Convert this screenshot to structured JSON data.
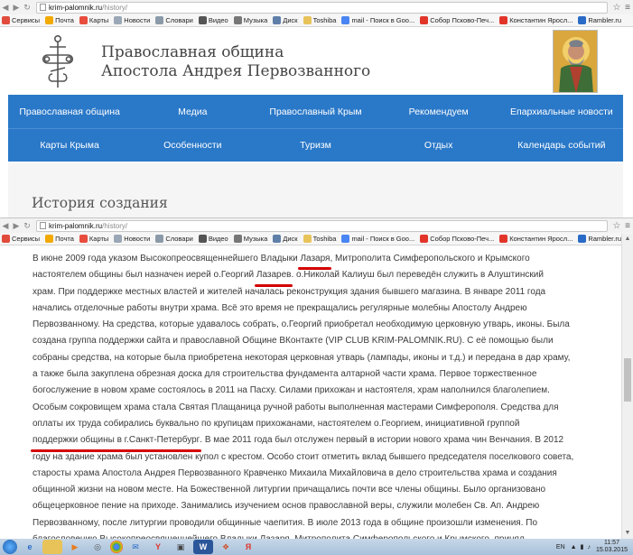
{
  "browser": {
    "url_domain": "krim-palomnik.ru",
    "url_path": "/history/",
    "bookmarks": [
      "Сервисы",
      "Почта",
      "Карты",
      "Новости",
      "Словари",
      "Видео",
      "Музыка",
      "Диск",
      "Toshiba",
      "mail - Поиск в Goo...",
      "Собор Псково-Печ...",
      "Константин Яросл...",
      "Rambler.ru"
    ]
  },
  "site": {
    "title_line1": "Православная община",
    "title_line2": "Апостола Андрея Первозванного"
  },
  "nav": {
    "row1": [
      "Православная община",
      "Медиа",
      "Православный Крым",
      "Рекомендуем",
      "Епархиальные новости"
    ],
    "row2": [
      "Карты Крыма",
      "Особенности",
      "Туризм",
      "Отдых",
      "Календарь событий"
    ]
  },
  "page_heading": "История создания",
  "article": {
    "l01": {
      "a": "В июне 2009 года указом Высокопреосвященнейшего Владыки ",
      "u": "Лазаря",
      "b": ", Митрополита Симферопольского и Крымского"
    },
    "l02": {
      "a": "настоятелем общины был назначен иерей о.Георгий ",
      "u": "Лазарев",
      "b": ". о.Николай Калиуш был переведён служить в Алуштинский"
    },
    "l03": "храм. При поддержке местных властей и жителей началась реконструкция здания бывшего магазина. В январе 2011 года",
    "l04": "начались отделочные работы внутри храма. Всё это время не прекращались регулярные молебны Апостолу Андрею",
    "l05": "Первозванному. На средства, которые удавалось собрать, о.Георгий приобретал необходимую церковную утварь, иконы. Была",
    "l06": "создана группа поддержки сайта и православной Общине ВКонтакте (VIP CLUB KRIM-PALOMNIK.RU). С её помощью были",
    "l07": "собраны средства, на которые была приобретена некоторая церковная утварь (лампады, иконы и т.д.) и передана в дар храму,",
    "l08": "а также была закуплена обрезная доска для строительства фундамента алтарной части храма. Первое торжественное",
    "l09": "богослужение в новом храме состоялось в 2011 на Пасху. Силами прихожан и настоятеля, храм наполнился благолепием.",
    "l10": "Особым сокровищем храма стала Святая Плащаница ручной работы выполненная мастерами Симферополя. Средства для",
    "l11": "оплаты их труда собирались буквально по крупицам прихожанами, настоятелем о.Георгием, инициативной группой",
    "l12": {
      "u": "поддержки общины в г.Санкт-Петербург",
      "b": ". В мае 2011 года был отслужен первый в истории нового храма чин Венчания. В 2012"
    },
    "l13": "году на здание храма был установлен купол с крестом. Особо стоит отметить вклад бывшего председателя поселкового совета,",
    "l14": "старосты храма Апостола Андрея Первозванного Кравченко Михаила Михайловича в дело строительства храма и создания",
    "l15": "общинной жизни на новом месте.  На Божественной литургии причащались почти все члены общины. Было организовано",
    "l16": "общецерковное пение на приходе. Занимались изучением основ православной веры, служили молебен Св. Ап. Андрею",
    "l17": "Первозванному, после литургии проводили общинные чаепития. В июле 2013 года в общине произошли изменения. По",
    "l18": "благословению Высокопреосвященнейшего Владыки Лазаря, Митрополита Симферопольского и Крымского, принял"
  },
  "taskbar": {
    "lang": "EN",
    "time": "11:57",
    "date": "15.03.2015"
  },
  "colors": {
    "nav_blue": "#2a78c8",
    "underline_red": "#d40000"
  }
}
